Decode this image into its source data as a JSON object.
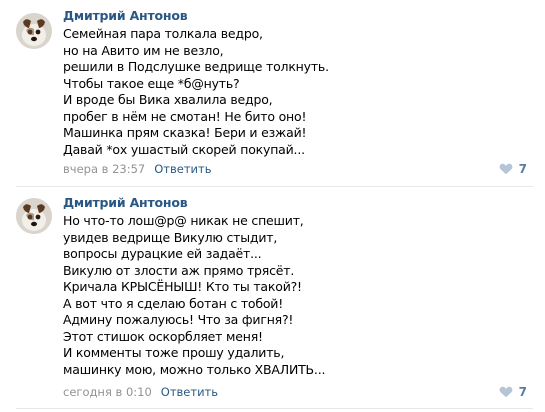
{
  "comments": [
    {
      "author": "Дмитрий Антонов",
      "lines": [
        "Семейная пара толкала ведро,",
        "но на Авито им не везло,",
        "решили в Подслушке ведрище толкнуть.",
        "Чтобы такое еще *б@нуть?",
        "И вроде бы Вика хвалила ведро,",
        "пробег в нём не смотан! Не бито оно!",
        "Машинка прям сказка! Бери и езжай!",
        "Давай *ох ушастый скорей покупай..."
      ],
      "time": "вчера в 23:57",
      "reply": "Ответить",
      "likes": "7",
      "like_icon": "heart-icon"
    },
    {
      "author": "Дмитрий Антонов",
      "lines": [
        "Но что-то лош@р@ никак не спешит,",
        "увидев ведрище Викулю стыдит,",
        "вопросы дурацкие ей задаёт...",
        "Викулю от злости аж прямо трясёт.",
        "Кричала КРЫСЁНЫШ! Кто ты такой?!",
        "А вот что я сделаю ботан с тобой!",
        "Админу пожалуюсь! Что за фигня?!",
        "Этот стишок оскорбляет меня!",
        "И комменты тоже прошу удалить,",
        "машинку мою, можно только ХВАЛИТЬ..."
      ],
      "time": "сегодня в 0:10",
      "reply": "Ответить",
      "likes": "7",
      "like_icon": "heart-icon"
    }
  ],
  "colors": {
    "author": "#2a5885",
    "meta": "#939393",
    "like": "#5b7ca3",
    "divider": "#e7e8ec"
  }
}
